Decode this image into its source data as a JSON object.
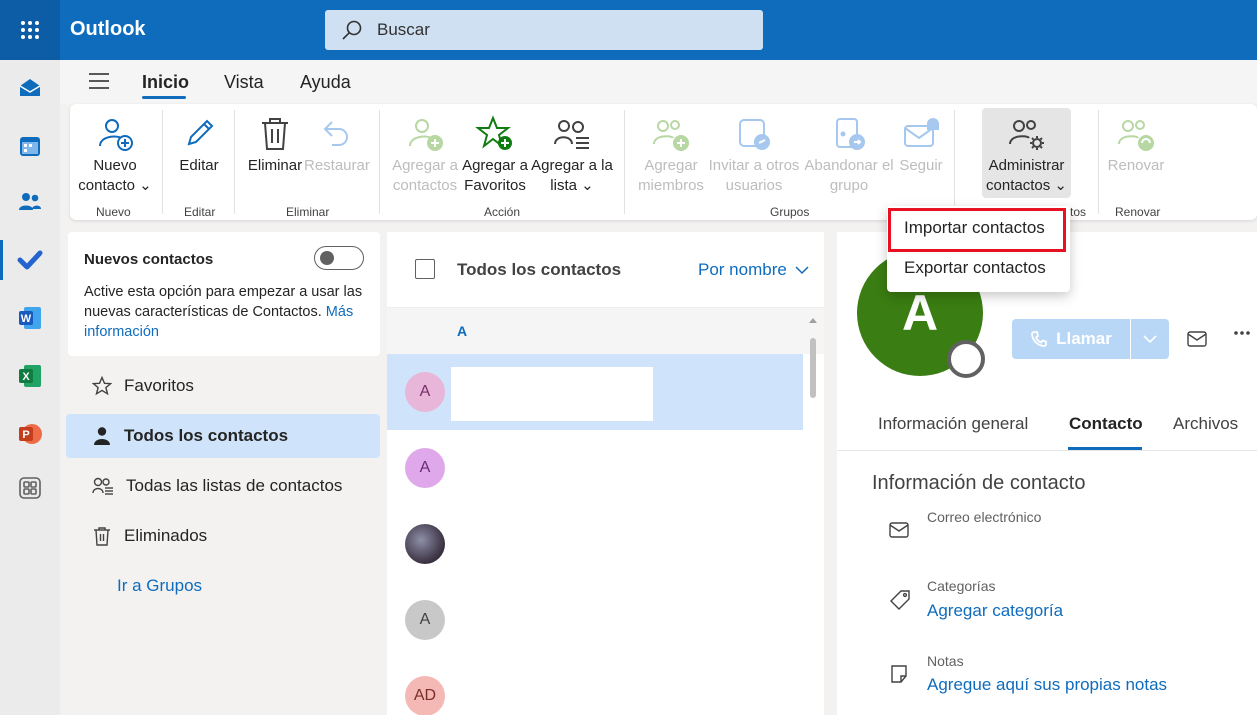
{
  "app": {
    "title": "Outlook"
  },
  "search": {
    "placeholder": "Buscar"
  },
  "tabs": [
    "Inicio",
    "Vista",
    "Ayuda"
  ],
  "ribbon": {
    "buttons": [
      {
        "label1": "Nuevo",
        "label2": "contacto ⌄"
      },
      {
        "label1": "Editar",
        "label2": ""
      },
      {
        "label1": "Eliminar",
        "label2": ""
      },
      {
        "label1": "Restaurar",
        "label2": ""
      },
      {
        "label1": "Agregar a",
        "label2": "contactos"
      },
      {
        "label1": "Agregar a",
        "label2": "Favoritos"
      },
      {
        "label1": "Agregar a la",
        "label2": "lista ⌄"
      },
      {
        "label1": "Agregar",
        "label2": "miembros"
      },
      {
        "label1": "Invitar a otros",
        "label2": "usuarios"
      },
      {
        "label1": "Abandonar el",
        "label2": "grupo"
      },
      {
        "label1": "Seguir",
        "label2": ""
      },
      {
        "label1": "Administrar",
        "label2": "contactos ⌄"
      },
      {
        "label1": "Renovar",
        "label2": ""
      }
    ],
    "groups": [
      "Nuevo",
      "Editar",
      "Eliminar",
      "Acción",
      "Grupos",
      "tos",
      "Renovar"
    ]
  },
  "newContacts": {
    "title": "Nuevos contactos",
    "body": "Active esta opción para empezar a usar las nuevas características de Contactos.",
    "link": "Más información"
  },
  "nav": {
    "items": [
      "Favoritos",
      "Todos los contactos",
      "Todas las listas de contactos",
      "Eliminados"
    ],
    "groupsLink": "Ir a Grupos"
  },
  "list": {
    "header": "Todos los contactos",
    "sort": "Por nombre",
    "letter": "A",
    "avatars": [
      "A",
      "A",
      "",
      "A",
      "AD"
    ]
  },
  "detail": {
    "avatar": "A",
    "call": "Llamar",
    "tabs": [
      "Información general",
      "Contacto",
      "Archivos"
    ],
    "sectionTitle": "Información de contacto",
    "email_label": "Correo electrónico",
    "categories_label": "Categorías",
    "categories_link": "Agregar categoría",
    "notes_label": "Notas",
    "notes_link": "Agregue aquí sus propias notas"
  },
  "menu": {
    "items": [
      "Importar contactos",
      "Exportar contactos"
    ]
  },
  "colors": {
    "brand": "#0f6cbd",
    "highlight": "#e81123",
    "avatarGreen": "#3a7d12"
  }
}
